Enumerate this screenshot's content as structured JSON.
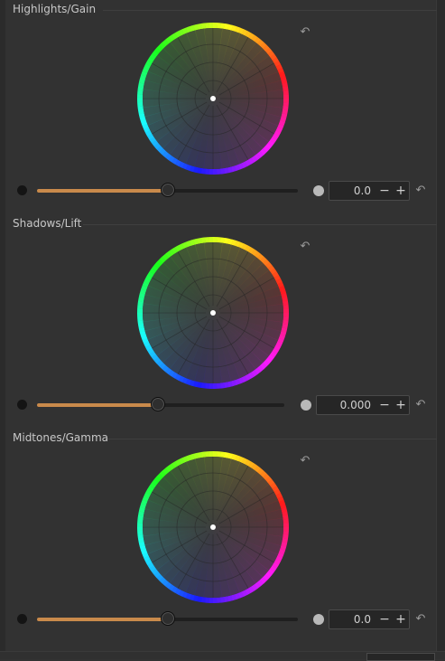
{
  "panels": [
    {
      "title": "Highlights/Gain",
      "slider_fraction": 0.5,
      "value": "0.0",
      "minus_label": "−",
      "plus_label": "+"
    },
    {
      "title": "Shadows/Lift",
      "slider_fraction": 0.49,
      "value": "0.000",
      "minus_label": "−",
      "plus_label": "+"
    },
    {
      "title": "Midtones/Gamma",
      "slider_fraction": 0.5,
      "value": "0.0",
      "minus_label": "−",
      "plus_label": "+"
    }
  ],
  "icons": {
    "reset": "reset-arrow-icon",
    "dark": "black-point-icon",
    "light": "white-point-icon"
  },
  "colors": {
    "slider_fill": "#c98a4b",
    "background": "#323232"
  }
}
